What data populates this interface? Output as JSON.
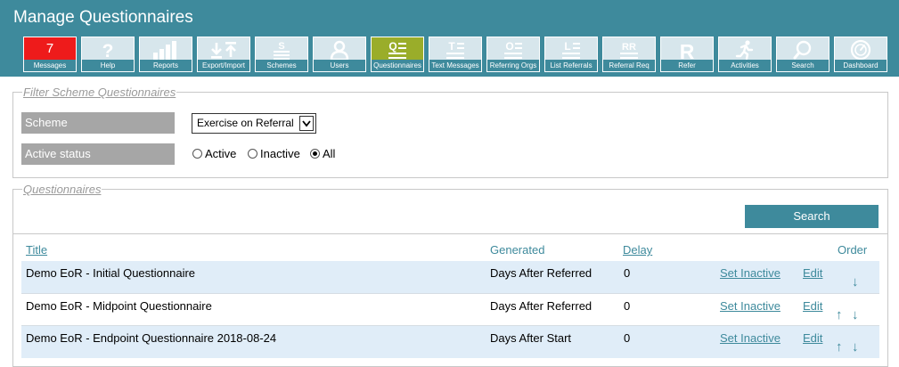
{
  "app": {
    "title": "Manage Questionnaires"
  },
  "nav": {
    "messages_count": "7",
    "items": [
      {
        "label": "Messages"
      },
      {
        "label": "Help"
      },
      {
        "label": "Reports"
      },
      {
        "label": "Export/Import"
      },
      {
        "label": "Schemes"
      },
      {
        "label": "Users"
      },
      {
        "label": "Questionnaires"
      },
      {
        "label": "Text Messages"
      },
      {
        "label": "Referring Orgs"
      },
      {
        "label": "List Referrals"
      },
      {
        "label": "Referral Req"
      },
      {
        "label": "Refer"
      },
      {
        "label": "Activities"
      },
      {
        "label": "Search"
      },
      {
        "label": "Dashboard"
      }
    ],
    "icon_glyphs": {
      "help": "?",
      "schemes": "S",
      "questionnaires": "Q",
      "text_messages": "T",
      "referring_orgs": "O",
      "list_referrals": "L",
      "referral_req": "RR",
      "refer": "R"
    },
    "colors": {
      "bar": "#3e8a9c",
      "button": "#d7e6ec",
      "alert": "#ee1b1b",
      "active": "#9aad2a"
    }
  },
  "filter": {
    "legend": "Filter Scheme Questionnaires",
    "scheme_label": "Scheme",
    "scheme_value": "Exercise on Referral",
    "status_label": "Active status",
    "status_options": [
      "Active",
      "Inactive",
      "All"
    ],
    "status_selected": "All"
  },
  "questionnaires": {
    "legend": "Questionnaires",
    "search_label": "Search",
    "columns": {
      "title": "Title",
      "generated": "Generated",
      "delay": "Delay",
      "order": "Order"
    },
    "rows": [
      {
        "title": "Demo EoR - Initial Questionnaire",
        "generated": "Days After Referred",
        "delay": "0",
        "action": "Set Inactive",
        "edit": "Edit",
        "up": "",
        "down": "↓"
      },
      {
        "title": "Demo EoR - Midpoint Questionnaire",
        "generated": "Days After Referred",
        "delay": "0",
        "action": "Set Inactive",
        "edit": "Edit",
        "up": "↑",
        "down": "↓"
      },
      {
        "title": "Demo EoR - Endpoint Questionnaire 2018-08-24",
        "generated": "Days After Start",
        "delay": "0",
        "action": "Set Inactive",
        "edit": "Edit",
        "up": "↑",
        "down": "↓"
      }
    ]
  }
}
